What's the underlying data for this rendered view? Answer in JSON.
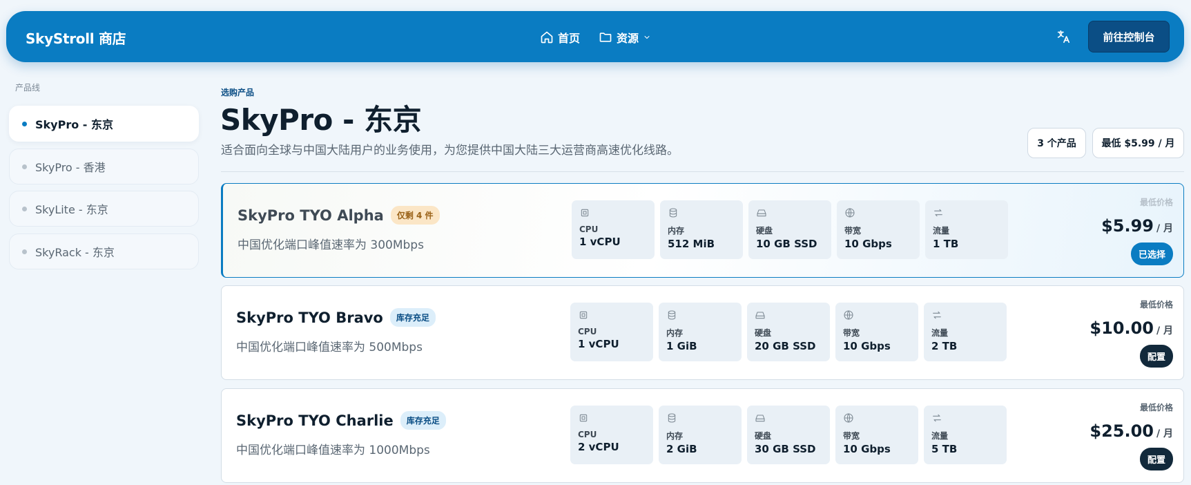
{
  "navbar": {
    "brand": "SkyStroll 商店",
    "home_label": "首页",
    "resources_label": "资源",
    "console_label": "前往控制台"
  },
  "sidebar": {
    "heading": "产品线",
    "items": [
      {
        "label": "SkyPro - 东京",
        "active": true
      },
      {
        "label": "SkyPro - 香港",
        "active": false
      },
      {
        "label": "SkyLite - 东京",
        "active": false
      },
      {
        "label": "SkyRack - 东京",
        "active": false
      }
    ]
  },
  "header": {
    "eyebrow": "选购产品",
    "title": "SkyPro - 东京",
    "description": "适合面向全球与中国大陆用户的业务使用，为您提供中国大陆三大运营商高速优化线路。",
    "count_chip": "3 个产品",
    "min_price_chip": "最低 $5.99 / 月"
  },
  "products": [
    {
      "name": "SkyPro TYO Alpha",
      "badge": "仅剩 4 件",
      "description": "中国优化端口峰值速率为 300Mbps",
      "specs": [
        {
          "icon": "cpu-icon",
          "label": "CPU",
          "value": "1 vCPU"
        },
        {
          "icon": "memory-icon",
          "label": "内存",
          "value": "512 MiB"
        },
        {
          "icon": "disk-icon",
          "label": "硬盘",
          "value": "10 GB SSD"
        },
        {
          "icon": "globe-icon",
          "label": "带宽",
          "value": "10 Gbps"
        },
        {
          "icon": "transfer-icon",
          "label": "流量",
          "value": "1 TB"
        }
      ],
      "price_label": "最低价格",
      "price": "$5.99",
      "unit": "/ 月",
      "button": "已选择"
    },
    {
      "name": "SkyPro TYO Bravo",
      "badge": "库存充足",
      "description": "中国优化端口峰值速率为 500Mbps",
      "specs": [
        {
          "icon": "cpu-icon",
          "label": "CPU",
          "value": "1 vCPU"
        },
        {
          "icon": "memory-icon",
          "label": "内存",
          "value": "1 GiB"
        },
        {
          "icon": "disk-icon",
          "label": "硬盘",
          "value": "20 GB SSD"
        },
        {
          "icon": "globe-icon",
          "label": "带宽",
          "value": "10 Gbps"
        },
        {
          "icon": "transfer-icon",
          "label": "流量",
          "value": "2 TB"
        }
      ],
      "price_label": "最低价格",
      "price": "$10.00",
      "unit": "/ 月",
      "button": "配置"
    },
    {
      "name": "SkyPro TYO Charlie",
      "badge": "库存充足",
      "description": "中国优化端口峰值速率为 1000Mbps",
      "specs": [
        {
          "icon": "cpu-icon",
          "label": "CPU",
          "value": "2 vCPU"
        },
        {
          "icon": "memory-icon",
          "label": "内存",
          "value": "2 GiB"
        },
        {
          "icon": "disk-icon",
          "label": "硬盘",
          "value": "30 GB SSD"
        },
        {
          "icon": "globe-icon",
          "label": "带宽",
          "value": "10 Gbps"
        },
        {
          "icon": "transfer-icon",
          "label": "流量",
          "value": "5 TB"
        }
      ],
      "price_label": "最低价格",
      "price": "$25.00",
      "unit": "/ 月",
      "button": "配置"
    }
  ],
  "colors": {
    "brand_blue": "#0a7cc2",
    "console_button": "#0b4e85",
    "dark_button": "#12293b",
    "low_stock_badge": "#fbe6c6",
    "in_stock_badge": "#dceefa"
  }
}
